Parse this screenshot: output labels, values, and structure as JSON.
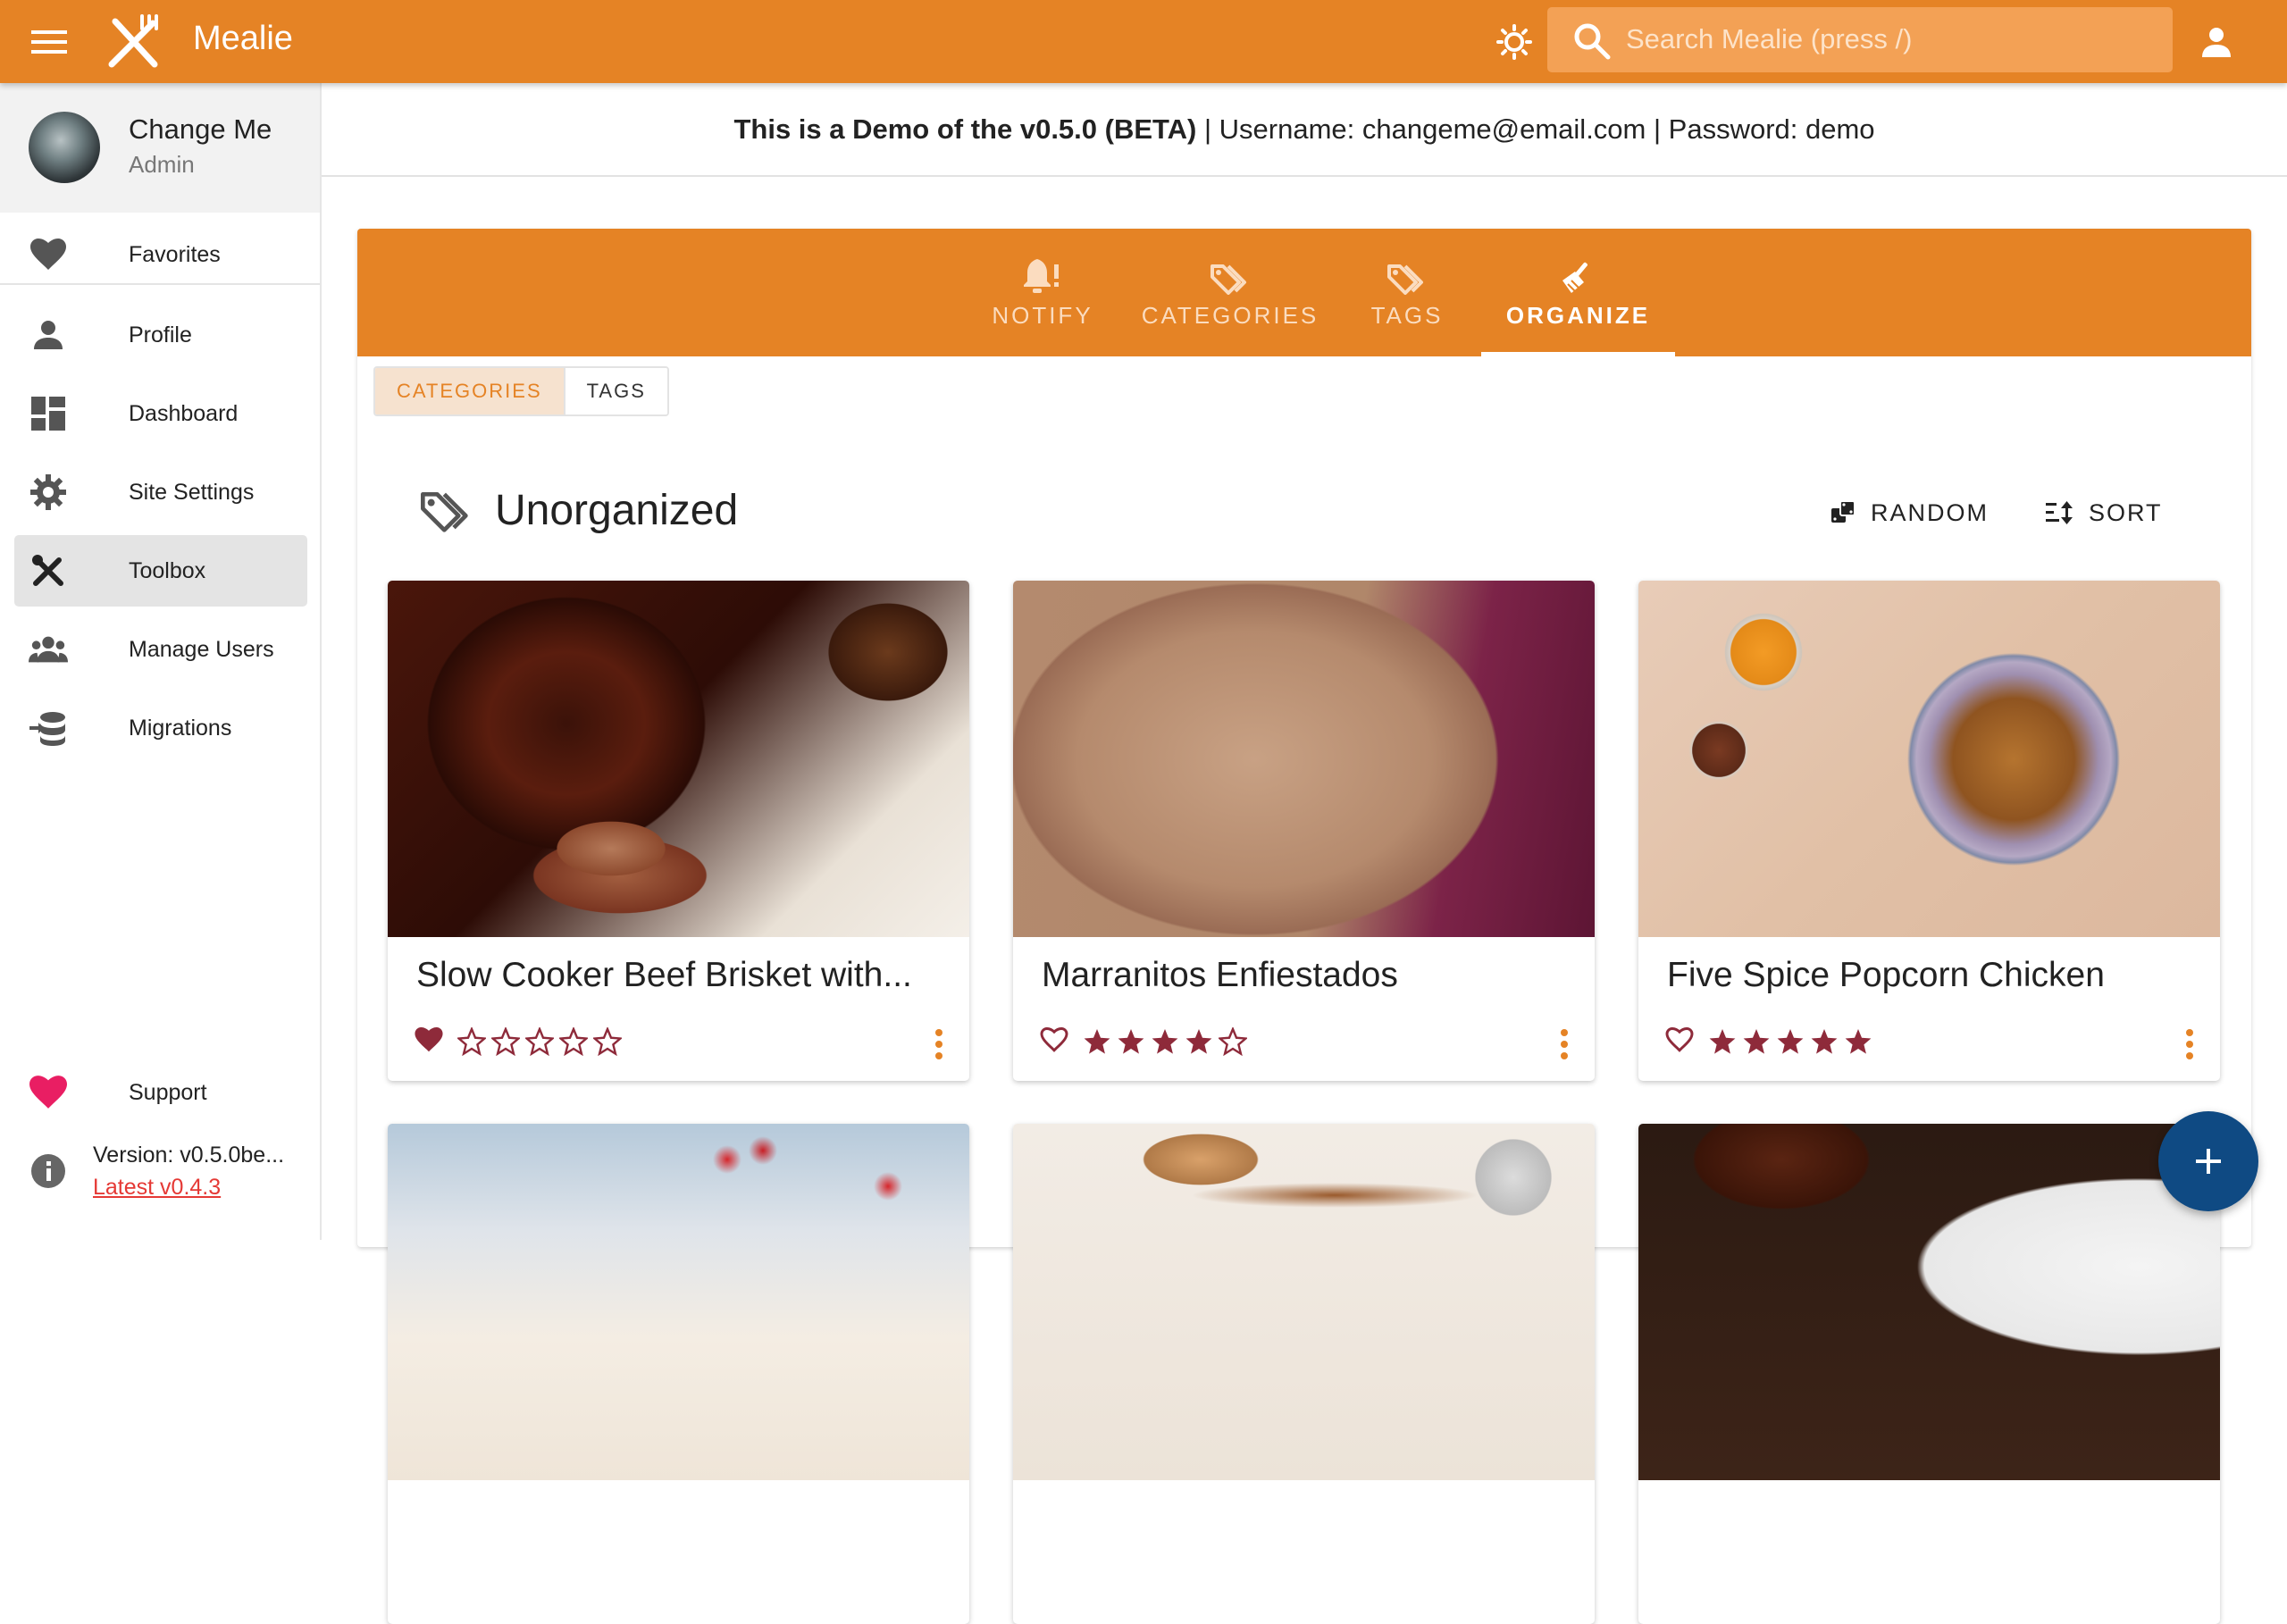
{
  "app": {
    "title": "Mealie"
  },
  "search": {
    "placeholder": "Search Mealie (press /)"
  },
  "user": {
    "name": "Change Me",
    "role": "Admin"
  },
  "nav": {
    "favorites": "Favorites",
    "profile": "Profile",
    "dashboard": "Dashboard",
    "site_settings": "Site Settings",
    "toolbox": "Toolbox",
    "manage_users": "Manage Users",
    "migrations": "Migrations",
    "support": "Support"
  },
  "version": {
    "text": "Version: v0.5.0be...",
    "latest": "Latest v0.4.3"
  },
  "banner": {
    "bold": "This is a Demo of the v0.5.0 (BETA)",
    "rest": " | Username: changeme@email.com | Password: demo"
  },
  "tabs": [
    {
      "label": "NOTIFY",
      "icon": "bell-alert-icon"
    },
    {
      "label": "CATEGORIES",
      "icon": "tags-icon"
    },
    {
      "label": "TAGS",
      "icon": "tags-icon"
    },
    {
      "label": "ORGANIZE",
      "icon": "broom-icon",
      "active": true
    }
  ],
  "toggle": {
    "categories": "CATEGORIES",
    "tags": "TAGS",
    "selected": "CATEGORIES"
  },
  "section": {
    "title": "Unorganized",
    "random": "RANDOM",
    "sort": "SORT"
  },
  "recipes": [
    {
      "title": "Slow Cooker Beef Brisket with...",
      "favorite": true,
      "rating": 0
    },
    {
      "title": "Marranitos Enfiestados",
      "favorite": false,
      "rating": 4
    },
    {
      "title": "Five Spice Popcorn Chicken",
      "favorite": false,
      "rating": 5
    }
  ],
  "colors": {
    "primary": "#e58325",
    "accent": "#0f4a83",
    "rating": "#8e2a3a",
    "link": "#e53935"
  }
}
